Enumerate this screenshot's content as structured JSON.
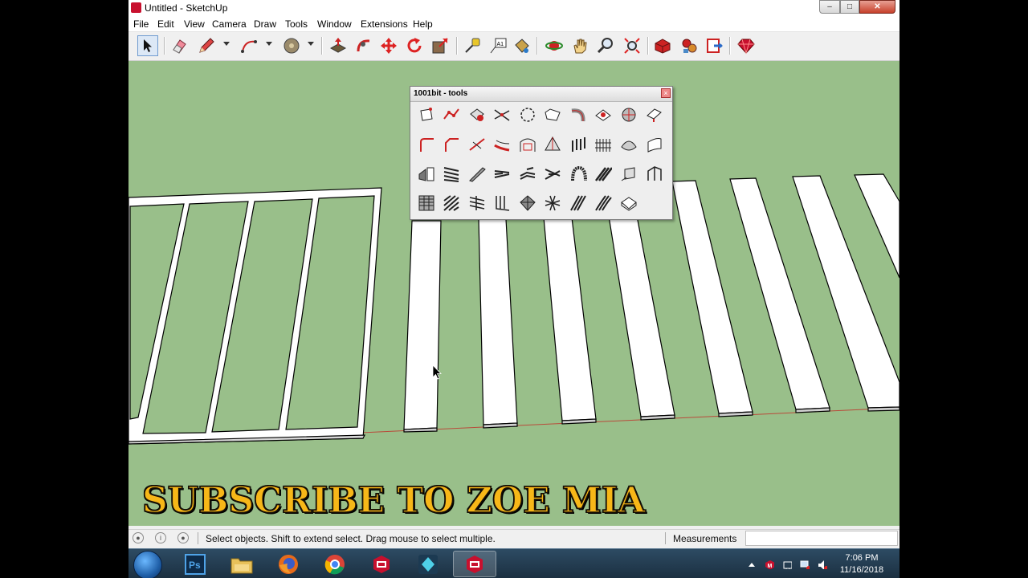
{
  "window": {
    "title": "Untitled - SketchUp"
  },
  "menu": {
    "items": [
      "File",
      "Edit",
      "View",
      "Camera",
      "Draw",
      "Tools",
      "Window",
      "Extensions",
      "Help"
    ]
  },
  "toolbar": {
    "tools": [
      "select-icon",
      "eraser-icon",
      "pencil-icon",
      "arc-icon",
      "shapes-icon",
      "push-pull-icon",
      "follow-me-icon",
      "move-icon",
      "rotate-icon",
      "scale-icon",
      "tape-measure-icon",
      "text-icon",
      "paint-bucket-icon",
      "orbit-icon",
      "pan-icon",
      "zoom-icon",
      "zoom-extents-icon",
      "warehouse-icon",
      "extension-warehouse-icon",
      "send-to-layout-icon",
      "ruby-icon"
    ]
  },
  "palette": {
    "title": "1001bit - tools"
  },
  "overlay": {
    "subscribe_text": "SUBSCRIBE TO ZOE MIA"
  },
  "status": {
    "hint": "Select objects. Shift to extend select. Drag mouse to select multiple.",
    "measurements_label": "Measurements",
    "measurements_value": ""
  },
  "taskbar": {
    "apps": [
      "photoshop",
      "file-explorer",
      "firefox",
      "chrome",
      "sketchup",
      "sketchup-app",
      "sketchup-window"
    ],
    "time": "7:06 PM",
    "date": "11/16/2018"
  },
  "colors": {
    "viewport": "#99bf8a",
    "subscribe_fill": "#f7b718",
    "accent_red": "#c8102e"
  }
}
